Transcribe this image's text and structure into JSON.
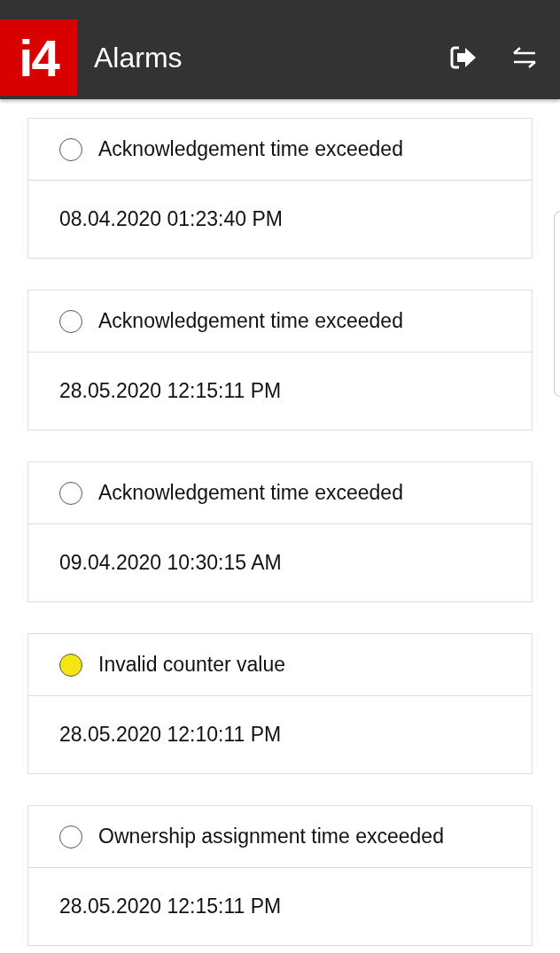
{
  "app_bar": {
    "logo": "i4",
    "title": "Alarms"
  },
  "alarms": [
    {
      "message": "Acknowledgement time exceeded",
      "time": "08.04.2020 01:23:40 PM",
      "color": "#ffffff"
    },
    {
      "message": "Acknowledgement time exceeded",
      "time": "28.05.2020 12:15:11 PM",
      "color": "#ffffff"
    },
    {
      "message": "Acknowledgement time exceeded",
      "time": "09.04.2020 10:30:15 AM",
      "color": "#ffffff"
    },
    {
      "message": "Invalid counter value",
      "time": "28.05.2020 12:10:11 PM",
      "color": "#f5e511"
    },
    {
      "message": "Ownership assignment time exceeded",
      "time": "28.05.2020 12:15:11 PM",
      "color": "#ffffff"
    }
  ]
}
